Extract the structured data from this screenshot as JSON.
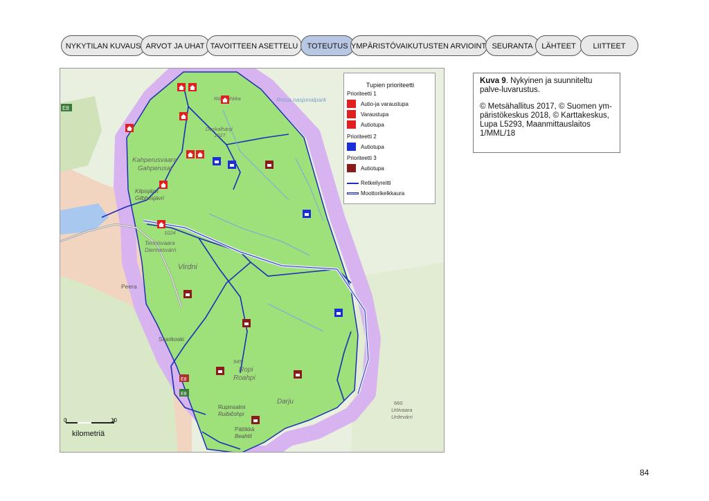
{
  "nav": {
    "tabs": [
      {
        "label": "NYKYTILAN KUVAUS",
        "active": false
      },
      {
        "label": "ARVOT JA UHAT",
        "active": false
      },
      {
        "label": "TAVOITTEEN ASETTELU",
        "active": false
      },
      {
        "label": "TOTEUTUS",
        "active": true
      },
      {
        "label": "YMPÄRISTÖVAIKUTUSTEN ARVIOINTI",
        "active": false
      },
      {
        "label": "SEURANTA",
        "active": false
      },
      {
        "label": "LÄHTEET",
        "active": false
      },
      {
        "label": "LIITTEET",
        "active": false
      }
    ]
  },
  "legend": {
    "title": "Tupien prioriteetti",
    "p1": "Prioriteetti 1",
    "p1_items": [
      "Autio-ja varaustupa",
      "Varaustupa",
      "Autiotupa"
    ],
    "p2": "Prioriteetti 2",
    "p2_items": [
      "Autiotupa"
    ],
    "p3": "Prioriteetti 3",
    "p3_items": [
      "Autiotupa"
    ],
    "route": "Retkeilyreitti",
    "snowmobile": "Moottorikelkkaura"
  },
  "colors": {
    "priority1": "#e02020",
    "priority2": "#1a2fd6",
    "priority3": "#8b1a1a",
    "area": "#9ee07a",
    "border_band": "#d7b3f0",
    "route": "#1a2fb5"
  },
  "caption": {
    "title": "Kuva 9",
    "text": ". Nykyinen ja suunniteltu palve-luvarustus.",
    "credits": "© Metsähallitus 2017, © Suomen ym-päristökeskus 2018, © Karttakeskus, Lupa L5293, Maanmittauslaitos 1/MML/18"
  },
  "scale": {
    "zero": "0",
    "ten": "10",
    "unit": "kilometriä"
  },
  "map_labels": {
    "reisa": "Reisa nasjonalpark",
    "e8": "E8",
    "kilpisjarvi": "Kilpisjärvi",
    "kilpisjarvi_s": "Gilbbesjávri",
    "kahperus": "Kahperusvaara",
    "gahperus": "Gahperusat",
    "ritnicohkka": "Ritničohkka",
    "doskalhanji": "Doskalhánji",
    "doskal_h": "1027",
    "termis": "Termisvaara",
    "diermes": "Diermesvárri",
    "h1024": "1024",
    "virdni": "Virdni",
    "peera": "Peera",
    "saarikoski": "Saarikoski",
    "ropi": "Ropi",
    "roahpi": "Roahpi",
    "h945": "945",
    "darju": "Darju",
    "rupinsalmi": "Rupinsalmi",
    "ruibicohpi": "Ruibičohpi",
    "pattikka": "Pättikkä",
    "beahtit": "Beahtit",
    "h660": "660",
    "urtivaara": "Urtivaara",
    "urdevarri": "Urdevárri",
    "e8b": "E8",
    "e8c": "E8"
  },
  "page_number": "84"
}
